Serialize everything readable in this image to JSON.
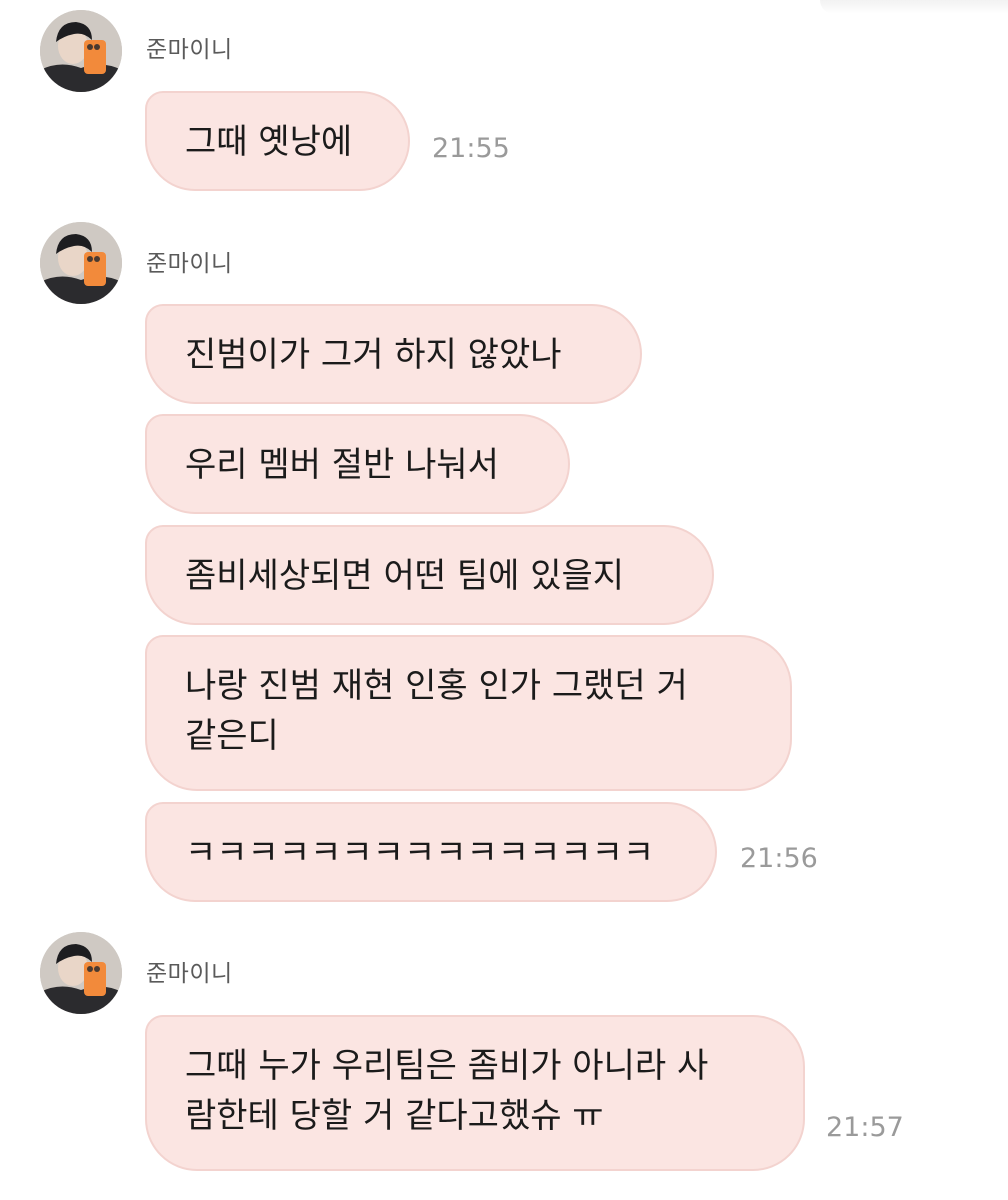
{
  "sender_name": "준마이니",
  "groups": [
    {
      "sender": "준마이니",
      "messages": [
        {
          "lines": [
            "그때 옛낭에"
          ],
          "time": "21:55"
        }
      ]
    },
    {
      "sender": "준마이니",
      "messages": [
        {
          "lines": [
            "진범이가 그거 하지 않았나"
          ]
        },
        {
          "lines": [
            "우리 멤버 절반 나눠서"
          ]
        },
        {
          "lines": [
            "좀비세상되면 어떤 팀에 있을지"
          ]
        },
        {
          "lines": [
            "나랑 진범 재현 인홍 인가 그랬던 거",
            "같은디"
          ]
        },
        {
          "lines": [
            "ㅋㅋㅋㅋㅋㅋㅋㅋㅋㅋㅋㅋㅋㅋㅋ"
          ],
          "time": "21:56"
        }
      ]
    },
    {
      "sender": "준마이니",
      "messages": [
        {
          "lines": [
            "그때 누가 우리팀은 좀비가 아니라 사",
            "람한테 당할 거 같다고했슈 ㅠ"
          ],
          "time": "21:57"
        }
      ]
    }
  ],
  "colors": {
    "bubble_fill": "#fbe5e2",
    "bubble_border": "#f3d3cf",
    "time_text": "#9a9a9a",
    "name_text": "#5a5a5a",
    "accent_phone_case": "#f28a3b"
  },
  "icons": {
    "avatar": "profile-photo-avatar"
  }
}
